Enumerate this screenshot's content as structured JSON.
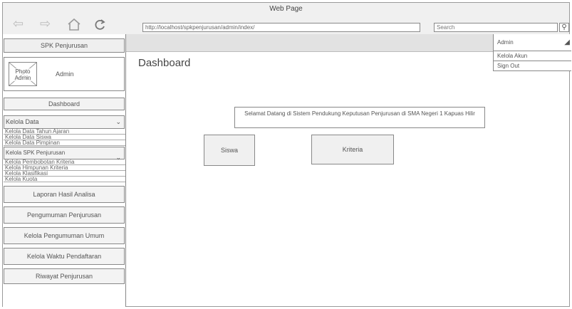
{
  "window": {
    "title": "Web Page"
  },
  "browser": {
    "url": "http://localhost/spkpenjurusan/admin/index/",
    "search_placeholder": "Search"
  },
  "sidebar": {
    "brand": "SPK Penjurusan",
    "photo_label": "Photo Admin",
    "admin_name": "Admin",
    "dashboard": "Dashboard",
    "kelola_data": {
      "label": "Kelola Data",
      "items": [
        "Kelola Data Tahun Ajaran",
        "Kelola Data Siswa",
        "Kelola Data Pimpinan"
      ]
    },
    "kelola_spk": {
      "label": "Kelola SPK Penjurusan",
      "items": [
        "Kelola Pembobotan Kriteria",
        "Kelola Himpunan Kriteria",
        "Kelola Klasifikasi",
        "Kelola Kuota"
      ]
    },
    "menu": [
      "Laporan Hasil Analisa",
      "Pengumuman Penjurusan",
      "Kelola Pengumuman Umum",
      "Kelola Waktu Pendaftaran",
      "Riwayat Penjurusan"
    ]
  },
  "account_menu": {
    "label": "Admin",
    "items": [
      "Kelola Akun",
      "Sign Out"
    ]
  },
  "main": {
    "title": "Dashboard",
    "welcome": "Selamat Datang di Sistem Pendukung Keputusan Penjurusan di SMA Negeri 1 Kapuas Hilir",
    "cards": [
      "Siswa",
      "Kriteria"
    ]
  }
}
